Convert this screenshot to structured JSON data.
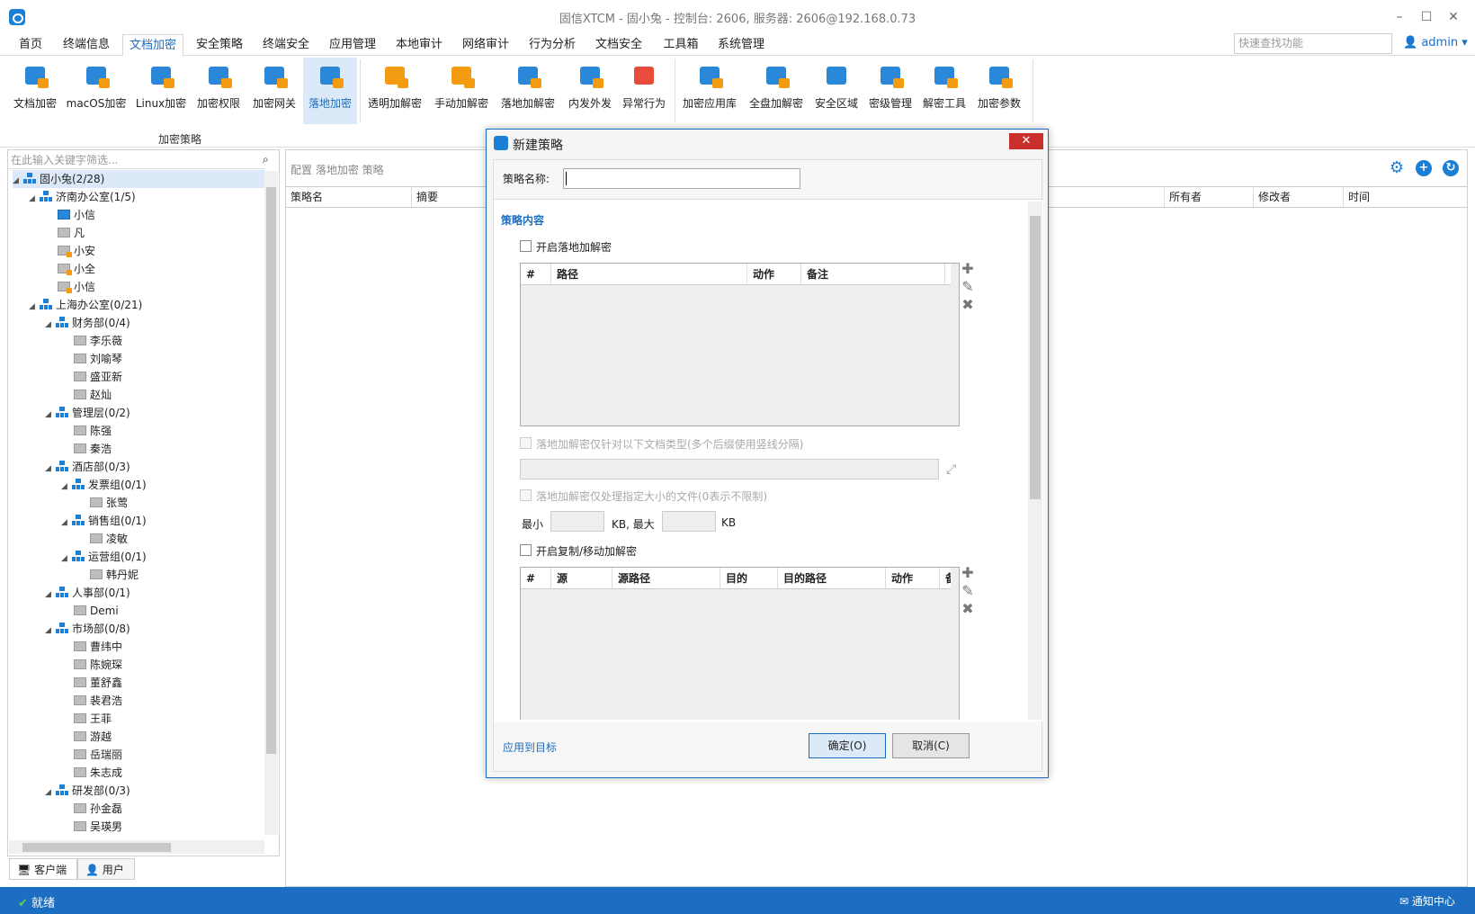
{
  "window": {
    "title": "固信XTCM - 固小兔 - 控制台: 2606, 服务器: 2606@192.168.0.73"
  },
  "menu": [
    "首页",
    "终端信息",
    "文档加密",
    "安全策略",
    "终端安全",
    "应用管理",
    "本地审计",
    "网络审计",
    "行为分析",
    "文档安全",
    "工具箱",
    "系统管理"
  ],
  "quick_search_placeholder": "快速查找功能",
  "user": "admin",
  "ribbon": {
    "buttons": [
      "文档加密",
      "macOS加密",
      "Linux加密",
      "加密权限",
      "加密网关",
      "落地加密",
      "透明加解密",
      "手动加解密",
      "落地加解密",
      "内发外发",
      "异常行为",
      "加密应用库",
      "全盘加解密",
      "安全区域",
      "密级管理",
      "解密工具",
      "加密参数"
    ],
    "group_label": "加密策略"
  },
  "tree": {
    "search_placeholder": "在此输入关键字筛选...",
    "rows": [
      "固小兔(2/28)",
      "济南办公室(1/5)",
      "小信",
      "凡",
      "小安",
      "小全",
      "小信",
      "上海办公室(0/21)",
      "财务部(0/4)",
      "李乐薇",
      "刘喻琴",
      "盛亚新",
      "赵灿",
      "管理层(0/2)",
      "陈强",
      "秦浩",
      "酒店部(0/3)",
      "发票组(0/1)",
      "张莺",
      "销售组(0/1)",
      "凌敏",
      "运营组(0/1)",
      "韩丹妮",
      "人事部(0/1)",
      "Demi",
      "市场部(0/8)",
      "曹纬中",
      "陈婉琛",
      "董舒鑫",
      "裴君浩",
      "王菲",
      "游越",
      "岳瑞丽",
      "朱志成",
      "研发部(0/3)",
      "孙金磊",
      "吴瑛男"
    ]
  },
  "panel_tabs": [
    "客户端",
    "用户"
  ],
  "breadcrumb": "配置 落地加密 策略",
  "grid_columns": [
    "策略名",
    "摘要",
    "所有者",
    "修改者",
    "时间"
  ],
  "status": {
    "text": "就绪",
    "notify": "通知中心"
  },
  "dialog": {
    "title": "新建策略",
    "name_label": "策略名称:",
    "section": "策略内容",
    "enable_label": "开启落地加解密",
    "table1_cols": [
      "#",
      "路径",
      "动作",
      "备注"
    ],
    "types_label": "落地加解密仅针对以下文档类型(多个后缀使用竖线分隔)",
    "size_label": "落地加解密仅处理指定大小的文件(0表示不限制)",
    "min_label": "最小",
    "kb_max_label": "KB, 最大",
    "kb_label": "KB",
    "copy_label": "开启复制/移动加解密",
    "table2_cols": [
      "#",
      "源",
      "源路径",
      "目的",
      "目的路径",
      "动作",
      "备"
    ],
    "apply_link": "应用到目标",
    "ok": "确定(O)",
    "cancel": "取消(C)"
  }
}
